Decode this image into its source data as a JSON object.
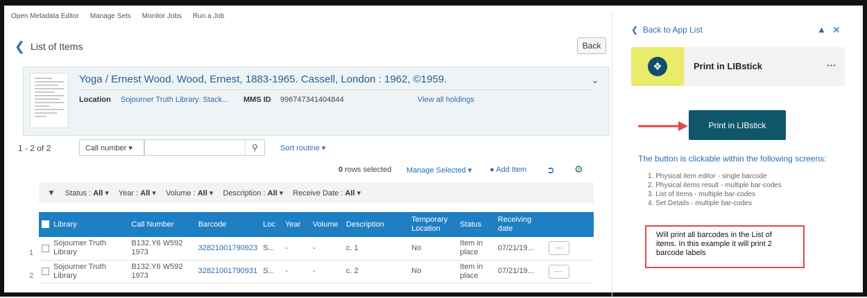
{
  "topnav": [
    "Open Metadata Editor",
    "Manage Sets",
    "Monitor Jobs",
    "Run a Job"
  ],
  "header": {
    "title": "List of Items",
    "back_label": "Back"
  },
  "record": {
    "title": "Yoga / Ernest Wood. Wood, Ernest, 1883-1965. Cassell, London : 1962, ©1959.",
    "location_label": "Location",
    "location_value": "Sojourner Truth Library: Stack...",
    "mms_label": "MMS ID",
    "mms_value": "996747341404844",
    "holdings_link": "View all holdings"
  },
  "toolbar": {
    "count": "1 - 2 of 2",
    "search_field": "Call number",
    "sort": "Sort routine",
    "rows_selected_num": "0",
    "rows_selected_text": "rows selected",
    "manage_selected": "Manage Selected",
    "add_item": "Add Item"
  },
  "filters": [
    {
      "label": "Status :",
      "value": "All"
    },
    {
      "label": "Year :",
      "value": "All"
    },
    {
      "label": "Volume :",
      "value": "All"
    },
    {
      "label": "Description :",
      "value": "All"
    },
    {
      "label": "Receive Date :",
      "value": "All"
    }
  ],
  "table": {
    "headers": [
      "Library",
      "Call Number",
      "Barcode",
      "Loc",
      "Year",
      "Volume",
      "Description",
      "Temporary Location",
      "Status",
      "Receiving date"
    ],
    "rows": [
      {
        "num": "1",
        "library": "Sojourner Truth Library",
        "call": "B132.Y6 W592 1973",
        "barcode": "32821001790923",
        "loc": "S...",
        "year": "-",
        "volume": "-",
        "description": "c. 1",
        "temp": "No",
        "status": "Item in place",
        "date": "07/21/19..."
      },
      {
        "num": "2",
        "library": "Sojourner Truth Library",
        "call": "B132.Y6 W592 1973",
        "barcode": "32821001790931",
        "loc": "S...",
        "year": "-",
        "volume": "-",
        "description": "c. 2",
        "temp": "No",
        "status": "Item in place",
        "date": "07/21/19..."
      }
    ]
  },
  "right_panel": {
    "back_link": "Back to App List",
    "app_name": "Print in LIBstick",
    "print_button": "Print in LIBstick",
    "info_text": "The button is clickable within the following screens:",
    "screens": [
      "1. Physical item editor - single barcode",
      "2. Physical items result - multiple bar-codes",
      "3. List of items - multiple bar-codes",
      "4. Set Details - multiple bar-codes"
    ],
    "note": "Will print all barcodes in the List of items. In this example it will print 2 barcode labels"
  },
  "colors": {
    "accent": "#1e7fc3",
    "print_button": "#10566a",
    "logo_bg": "#e8ec6a",
    "annotation": "#e04848"
  }
}
